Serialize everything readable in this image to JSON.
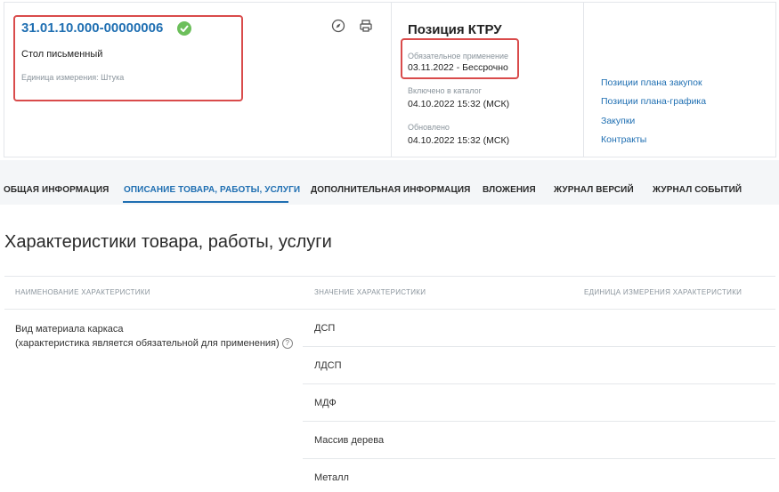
{
  "header": {
    "code": "31.01.10.000-00000006",
    "product_name": "Стол письменный",
    "unit_label": "Единица измерения: Штука",
    "icons": [
      "compass-icon",
      "print-icon"
    ]
  },
  "ktru": {
    "title": "Позиция КТРУ",
    "mandatory_label": "Обязательное применение",
    "mandatory_value": "03.11.2022  - Бессрочно",
    "included_label": "Включено в каталог",
    "included_value": "04.10.2022 15:32 (МСК)",
    "updated_label": "Обновлено",
    "updated_value": "04.10.2022 15:32 (МСК)"
  },
  "links": [
    "Позиции плана закупок",
    "Позиции плана-графика",
    "Закупки",
    "Контракты"
  ],
  "tabs": [
    "ОБЩАЯ ИНФОРМАЦИЯ",
    "ОПИСАНИЕ ТОВАРА, РАБОТЫ, УСЛУГИ",
    "ДОПОЛНИТЕЛЬНАЯ ИНФОРМАЦИЯ",
    "ВЛОЖЕНИЯ",
    "ЖУРНАЛ ВЕРСИЙ",
    "ЖУРНАЛ СОБЫТИЙ"
  ],
  "active_tab": "ОПИСАНИЕ ТОВАРА, РАБОТЫ, УСЛУГИ",
  "section": {
    "title": "Характеристики товара, работы, услуги",
    "columns": [
      "НАИМЕНОВАНИЕ ХАРАКТЕРИСТИКИ",
      "ЗНАЧЕНИЕ ХАРАКТЕРИСТИКИ",
      "ЕДИНИЦА ИЗМЕРЕНИЯ ХАРАКТЕРИСТИКИ"
    ],
    "characteristic_name": "Вид материала каркаса",
    "characteristic_note": "(характеристика является обязательной для применения)",
    "help_symbol": "?",
    "values": [
      "ДСП",
      "ЛДСП",
      "МДФ",
      "Массив дерева",
      "Металл"
    ]
  },
  "colors": {
    "accent": "#1f6fb2",
    "highlight": "#d94b4b",
    "success": "#6cbf5b"
  }
}
